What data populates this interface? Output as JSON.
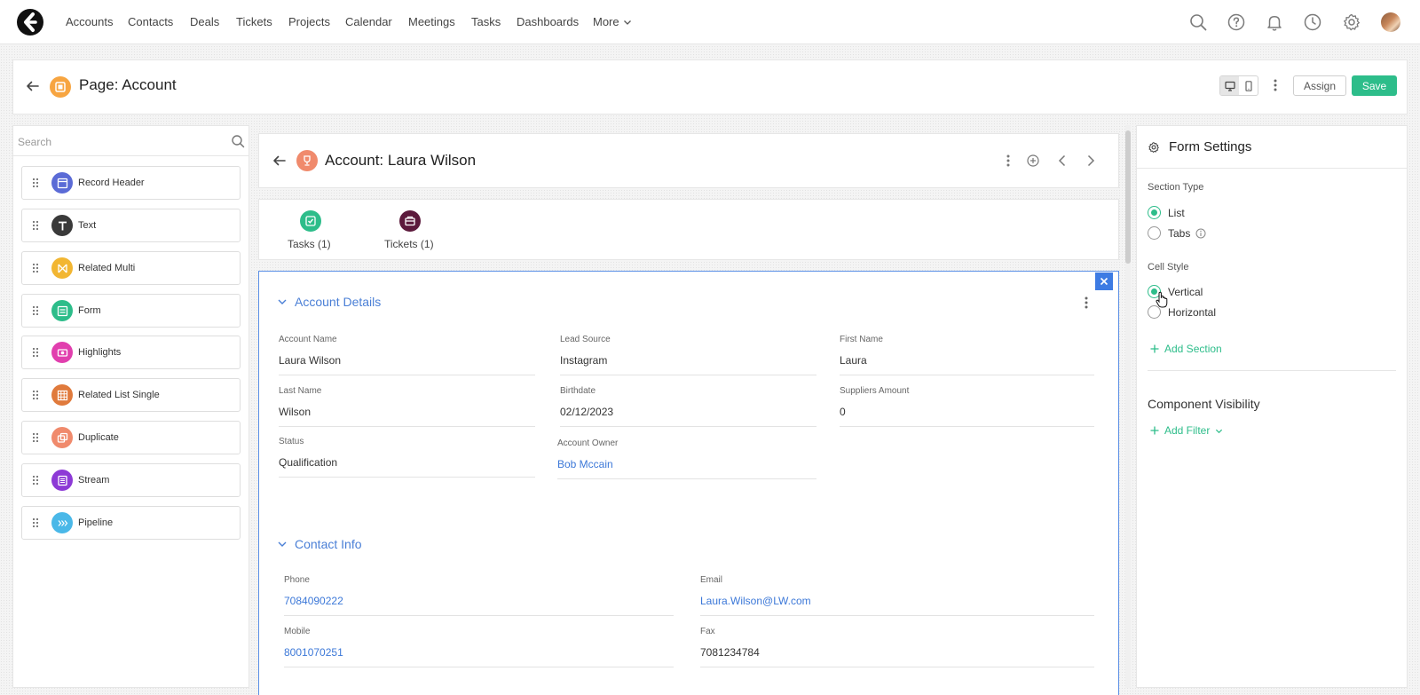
{
  "nav": {
    "items": [
      "Accounts",
      "Contacts",
      "Deals",
      "Tickets",
      "Projects",
      "Calendar",
      "Meetings",
      "Tasks",
      "Dashboards"
    ],
    "more_label": "More"
  },
  "page": {
    "title": "Page: Account",
    "assign_label": "Assign",
    "save_label": "Save"
  },
  "components": {
    "search_placeholder": "Search",
    "items": [
      {
        "label": "Record Header",
        "color": "#5b6bd6",
        "icon": "record-header-icon"
      },
      {
        "label": "Text",
        "color": "#3a3a3a",
        "icon": "text-icon"
      },
      {
        "label": "Related Multi",
        "color": "#f2b632",
        "icon": "related-multi-icon"
      },
      {
        "label": "Form",
        "color": "#2dbd8a",
        "icon": "form-icon"
      },
      {
        "label": "Highlights",
        "color": "#e13fae",
        "icon": "highlights-icon"
      },
      {
        "label": "Related List Single",
        "color": "#e07a3c",
        "icon": "related-list-icon"
      },
      {
        "label": "Duplicate",
        "color": "#f08a6c",
        "icon": "duplicate-icon"
      },
      {
        "label": "Stream",
        "color": "#8d3ad6",
        "icon": "stream-icon"
      },
      {
        "label": "Pipeline",
        "color": "#4ab8e8",
        "icon": "pipeline-icon"
      }
    ]
  },
  "record": {
    "title": "Account: Laura Wilson"
  },
  "related": {
    "tabs": [
      {
        "label": "Tasks (1)",
        "color": "#2dbd8a",
        "icon": "task-check-icon"
      },
      {
        "label": "Tickets (1)",
        "color": "#5c1a3c",
        "icon": "ticket-icon"
      }
    ]
  },
  "account_details": {
    "title": "Account Details",
    "fields": [
      {
        "label": "Account Name",
        "value": "Laura Wilson"
      },
      {
        "label": "Lead Source",
        "value": "Instagram"
      },
      {
        "label": "First Name",
        "value": "Laura"
      },
      {
        "label": "Last Name",
        "value": "Wilson"
      },
      {
        "label": "Birthdate",
        "value": "02/12/2023"
      },
      {
        "label": "Suppliers Amount",
        "value": "0"
      },
      {
        "label": "Status",
        "value": "Qualification"
      },
      {
        "label": "Account Owner",
        "value": "Bob Mccain"
      }
    ]
  },
  "contact_info": {
    "title": "Contact Info",
    "fields": [
      {
        "label": "Phone",
        "value": "7084090222"
      },
      {
        "label": "Email",
        "value": "Laura.Wilson@LW.com"
      },
      {
        "label": "Mobile",
        "value": "8001070251"
      },
      {
        "label": "Fax",
        "value": "7081234784"
      }
    ]
  },
  "form_settings": {
    "title": "Form Settings",
    "section_type_label": "Section Type",
    "section_type_options": [
      "List",
      "Tabs"
    ],
    "section_type_selected": "List",
    "cell_style_label": "Cell Style",
    "cell_style_options": [
      "Vertical",
      "Horizontal"
    ],
    "cell_style_selected": "Vertical",
    "add_section_label": "Add Section",
    "visibility_title": "Component Visibility",
    "add_filter_label": "Add Filter"
  },
  "colors": {
    "accent_green": "#2dbd8a",
    "link_blue": "#3c78d8",
    "section_blue": "#4a7fd6",
    "selection_border": "#5a8fe6"
  }
}
